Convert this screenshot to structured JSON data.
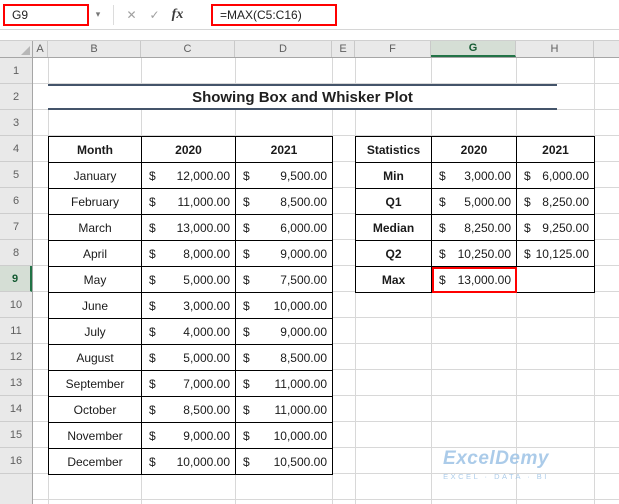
{
  "formula_bar": {
    "name_box_value": "G9",
    "formula_value": "=MAX(C5:C16)",
    "cancel_label": "✕",
    "enter_label": "✓",
    "fx_label": "fx",
    "dropdown_glyph": "▾"
  },
  "sheet": {
    "column_headers": [
      "A",
      "B",
      "C",
      "D",
      "E",
      "F",
      "G",
      "H"
    ],
    "row_headers": [
      "1",
      "2",
      "3",
      "4",
      "5",
      "6",
      "7",
      "8",
      "9",
      "10",
      "11",
      "12",
      "13",
      "14",
      "15",
      "16"
    ],
    "selected_cell": "G9",
    "selected_column": "G",
    "selected_row": "9"
  },
  "title": "Showing Box and Whisker Plot",
  "currency": "$",
  "monthly_table": {
    "headers": [
      "Month",
      "2020",
      "2021"
    ],
    "rows": [
      {
        "month": "January",
        "y2020": "12,000.00",
        "y2021": "9,500.00"
      },
      {
        "month": "February",
        "y2020": "11,000.00",
        "y2021": "8,500.00"
      },
      {
        "month": "March",
        "y2020": "13,000.00",
        "y2021": "6,000.00"
      },
      {
        "month": "April",
        "y2020": "8,000.00",
        "y2021": "9,000.00"
      },
      {
        "month": "May",
        "y2020": "5,000.00",
        "y2021": "7,500.00"
      },
      {
        "month": "June",
        "y2020": "3,000.00",
        "y2021": "10,000.00"
      },
      {
        "month": "July",
        "y2020": "4,000.00",
        "y2021": "9,000.00"
      },
      {
        "month": "August",
        "y2020": "5,000.00",
        "y2021": "8,500.00"
      },
      {
        "month": "September",
        "y2020": "7,000.00",
        "y2021": "11,000.00"
      },
      {
        "month": "October",
        "y2020": "8,500.00",
        "y2021": "11,000.00"
      },
      {
        "month": "November",
        "y2020": "9,000.00",
        "y2021": "10,000.00"
      },
      {
        "month": "December",
        "y2020": "10,000.00",
        "y2021": "10,500.00"
      }
    ]
  },
  "stats_table": {
    "headers": [
      "Statistics",
      "2020",
      "2021"
    ],
    "rows": [
      {
        "stat": "Min",
        "y2020": "3,000.00",
        "y2021": "6,000.00"
      },
      {
        "stat": "Q1",
        "y2020": "5,000.00",
        "y2021": "8,250.00"
      },
      {
        "stat": "Median",
        "y2020": "8,250.00",
        "y2021": "9,250.00"
      },
      {
        "stat": "Q2",
        "y2020": "10,250.00",
        "y2021": "10,125.00"
      },
      {
        "stat": "Max",
        "y2020": "13,000.00",
        "y2021": ""
      }
    ]
  },
  "watermark": {
    "brand": "ExcelDemy",
    "tagline": "EXCEL · DATA · BI"
  },
  "colors": {
    "month_header_bg": "#C6E0B4",
    "stats_header_bg": "#FCE4D6",
    "stat_label_bg": "#CDD2EC",
    "annotation_red": "#FF0000",
    "selection_green": "#217346",
    "title_border": "#44546A",
    "watermark_blue": "#9DC3E6"
  }
}
